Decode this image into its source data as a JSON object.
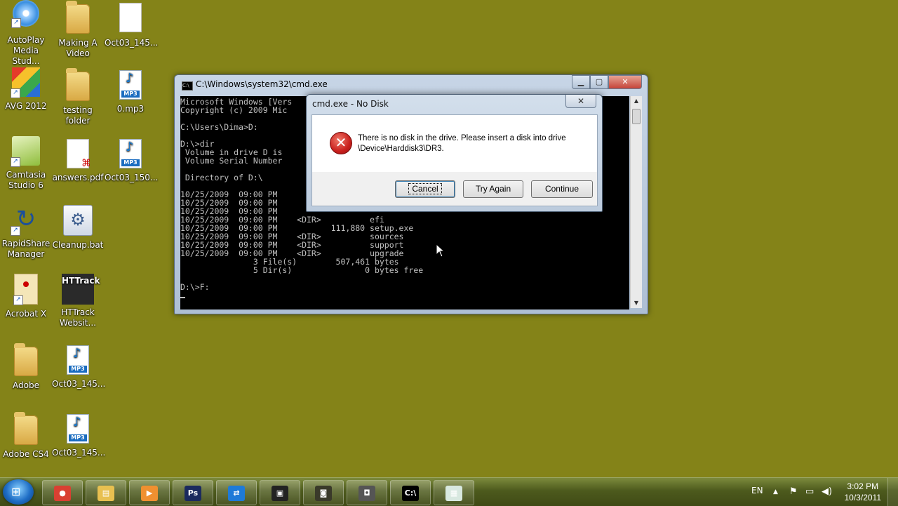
{
  "desktop_icons": [
    {
      "label": "AutoPlay Media Stud...",
      "icon": "autoplay-disc-icon"
    },
    {
      "label": "Making A Video",
      "icon": "folder-icon"
    },
    {
      "label": "Oct03_145...",
      "icon": "blank-file-icon"
    },
    {
      "label": "AVG 2012",
      "icon": "avg-icon"
    },
    {
      "label": "testing folder",
      "icon": "folder-icon"
    },
    {
      "label": "0.mp3",
      "icon": "mp3-icon"
    },
    {
      "label": "Camtasia Studio 6",
      "icon": "camtasia-icon"
    },
    {
      "label": "answers.pdf",
      "icon": "pdf-icon"
    },
    {
      "label": "Oct03_150...",
      "icon": "mp3-icon"
    },
    {
      "label": "RapidShare Manager",
      "icon": "rapidshare-icon"
    },
    {
      "label": "Cleanup.bat",
      "icon": "batch-file-icon"
    },
    {
      "label": "Acrobat X",
      "icon": "acrobat-icon"
    },
    {
      "label": "HTTrack Websit...",
      "icon": "httrack-icon"
    },
    {
      "label": "Adobe",
      "icon": "folder-icon"
    },
    {
      "label": "Oct03_145...",
      "icon": "mp3-icon"
    },
    {
      "label": "Adobe CS4",
      "icon": "folder-icon"
    },
    {
      "label": "Oct03_145...",
      "icon": "mp3-icon"
    }
  ],
  "mp3_badge": "MP3",
  "cmd_window": {
    "title": "C:\\Windows\\system32\\cmd.exe",
    "icon_text": "C:\\",
    "minimize": "▁",
    "maximize": "▢",
    "close": "✕",
    "lines": [
      "Microsoft Windows [Vers",
      "Copyright (c) 2009 Mic",
      "",
      "C:\\Users\\Dima>D:",
      "",
      "D:\\>dir",
      " Volume in drive D is ",
      " Volume Serial Number ",
      "",
      " Directory of D:\\",
      "",
      "10/25/2009  09:00 PM",
      "10/25/2009  09:00 PM",
      "10/25/2009  09:00 PM",
      "10/25/2009  09:00 PM    <DIR>          efi",
      "10/25/2009  09:00 PM           111,880 setup.exe",
      "10/25/2009  09:00 PM    <DIR>          sources",
      "10/25/2009  09:00 PM    <DIR>          support",
      "10/25/2009  09:00 PM    <DIR>          upgrade",
      "               3 File(s)        507,461 bytes",
      "               5 Dir(s)               0 bytes free",
      "",
      "D:\\>F:"
    ]
  },
  "dialog": {
    "title": "cmd.exe - No Disk",
    "close": "✕",
    "error_glyph": "✕",
    "message_line1": "There is no disk in the drive. Please insert a disk into drive",
    "message_line2": "\\Device\\Harddisk3\\DR3.",
    "buttons": {
      "cancel": "Cancel",
      "try_again": "Try Again",
      "continue": "Continue"
    }
  },
  "taskbar": {
    "apps": [
      {
        "name": "chrome",
        "glyph": "●",
        "color": "#d94032"
      },
      {
        "name": "explorer",
        "glyph": "▤",
        "color": "#e8c050"
      },
      {
        "name": "media-player",
        "glyph": "▶",
        "color": "#f09030"
      },
      {
        "name": "photoshop",
        "glyph": "Ps",
        "color": "#1b2a5e"
      },
      {
        "name": "teamviewer",
        "glyph": "⇄",
        "color": "#1e7ad8"
      },
      {
        "name": "screen-recorder",
        "glyph": "▣",
        "color": "#222222"
      },
      {
        "name": "camera",
        "glyph": "◙",
        "color": "#3a3a2a"
      },
      {
        "name": "capture-card",
        "glyph": "◘",
        "color": "#555555"
      },
      {
        "name": "cmd",
        "glyph": "C:\\",
        "color": "#000000"
      },
      {
        "name": "notepad",
        "glyph": "▦",
        "color": "#d8e8e0"
      }
    ],
    "language": "EN",
    "tray_arrow": "▲",
    "time": "3:02 PM",
    "date": "10/3/2011"
  },
  "colors": {
    "desktop": "#848318",
    "error": "#c9201d"
  }
}
